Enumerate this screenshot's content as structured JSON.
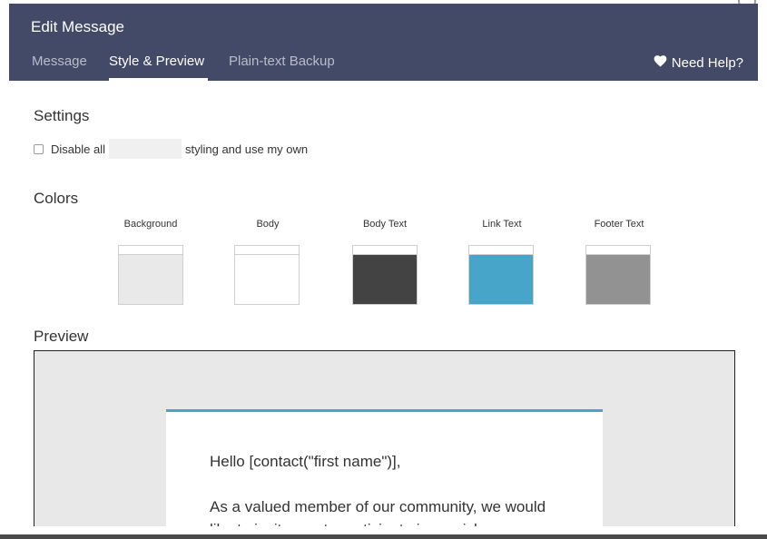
{
  "header": {
    "title": "Edit Message",
    "tabs": [
      {
        "label": "Message",
        "active": false
      },
      {
        "label": "Style & Preview",
        "active": true
      },
      {
        "label": "Plain-text Backup",
        "active": false
      }
    ],
    "help_label": "Need Help?",
    "help_icon": "heart-icon"
  },
  "settings": {
    "title": "Settings",
    "disable_prefix": "Disable all",
    "disable_suffix": "styling and use my own",
    "checked": false
  },
  "colors": {
    "title": "Colors",
    "swatches": [
      {
        "label": "Background",
        "color": "#e9e9e9"
      },
      {
        "label": "Body",
        "color": "#ffffff"
      },
      {
        "label": "Body Text",
        "color": "#434343"
      },
      {
        "label": "Link Text",
        "color": "#46a5c8"
      },
      {
        "label": "Footer Text",
        "color": "#929292"
      }
    ]
  },
  "preview": {
    "title": "Preview",
    "greeting": "Hello [contact(\"first name\")],",
    "body_line": "As a valued member of our community, we would",
    "body_line2": "like to invite you to participate in a quick survey"
  }
}
